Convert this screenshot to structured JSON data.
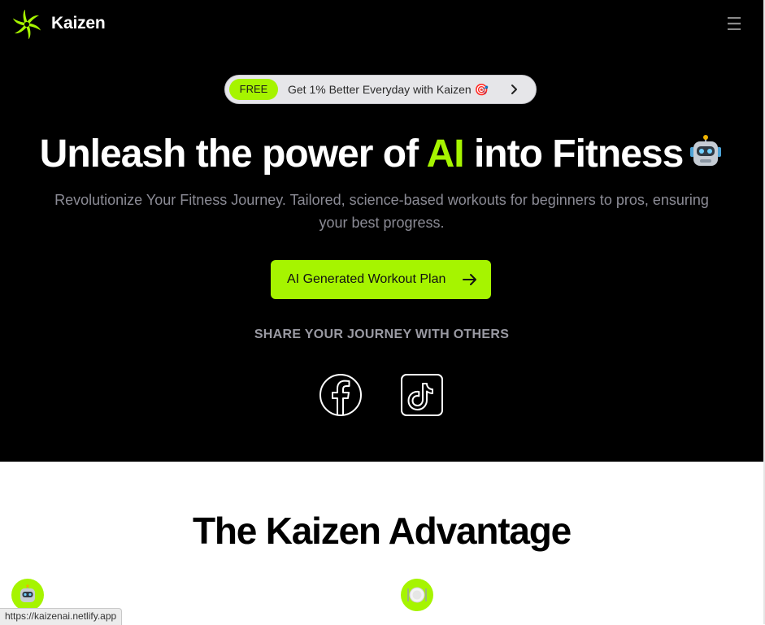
{
  "header": {
    "brand": "Kaizen",
    "logo_icon": "kaizen-swirl-logo",
    "menu_icon": "hamburger-menu-icon",
    "menu_glyph": "☰"
  },
  "promo": {
    "badge": "FREE",
    "text": "Get 1% Better Everyday with Kaizen 🎯",
    "arrow_icon": "chevron-right-icon"
  },
  "hero": {
    "title_before": "Unleash the power of ",
    "title_highlight": "AI",
    "title_after": " into Fitness",
    "title_emoji_icon": "robot-emoji-icon",
    "subtitle": "Revolutionize Your Fitness Journey. Tailored, science-based workouts for beginners to pros, ensuring your best progress.",
    "cta_label": "AI Generated Workout Plan",
    "cta_icon": "arrow-right-icon",
    "share_heading": "SHARE YOUR JOURNEY WITH OTHERS",
    "social": [
      {
        "name": "Facebook",
        "icon": "facebook-icon"
      },
      {
        "name": "TikTok",
        "icon": "tiktok-icon"
      }
    ]
  },
  "advantage": {
    "title": "The Kaizen Advantage",
    "features": [
      {
        "icon": "robot-emoji-icon"
      },
      {
        "icon": "plate-emoji-icon"
      }
    ]
  },
  "status_bar": {
    "url": "https://kaizenai.netlify.app"
  },
  "colors": {
    "accent": "#a6f400",
    "hero_bg": "#000000",
    "page_bg": "#ffffff",
    "subtitle": "#8b8b95"
  }
}
